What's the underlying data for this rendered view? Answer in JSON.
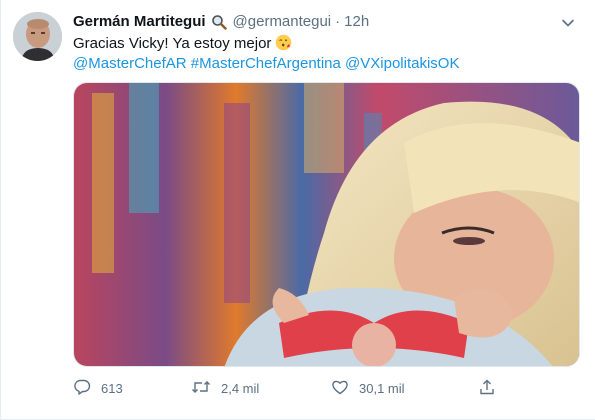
{
  "tweet": {
    "author_name": "Germán Martitegui",
    "author_badge_icon": "magnifying-glass-emoji",
    "handle": "@germantegui",
    "separator": "·",
    "time": "12h",
    "text": "Gracias Vicky! Ya estoy mejor",
    "text_emoji": "face-blowing-a-kiss-emoji",
    "links": [
      "@MasterChefAR",
      "#MasterChefArgentina",
      "@VXipolitakisOK"
    ],
    "more_icon": "chevron-down-icon"
  },
  "actions": {
    "reply": {
      "icon": "reply-icon",
      "count": "613"
    },
    "retweet": {
      "icon": "retweet-icon",
      "count": "2,4 mil"
    },
    "like": {
      "icon": "heart-icon",
      "count": "30,1 mil"
    },
    "share": {
      "icon": "share-icon"
    }
  },
  "colors": {
    "link": "#1b95e0",
    "muted": "#5b7083",
    "text": "#0f1419"
  }
}
